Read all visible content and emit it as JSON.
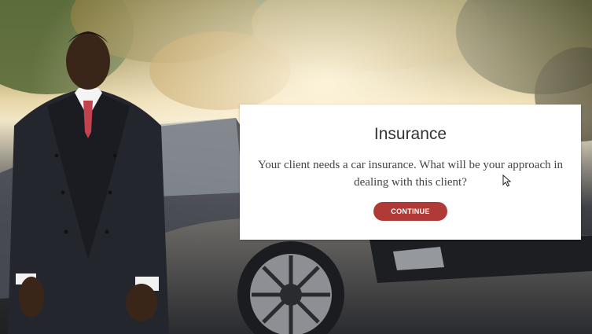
{
  "dialog": {
    "title": "Insurance",
    "message": "Your client needs a car insurance. What will be your approach in dealing with this client?",
    "continue_label": "CONTINUE"
  },
  "colors": {
    "accent": "#b03a35",
    "card_background": "#ffffff",
    "title_text": "#333333"
  },
  "icons": {
    "cursor": "mouse-pointer-icon"
  }
}
